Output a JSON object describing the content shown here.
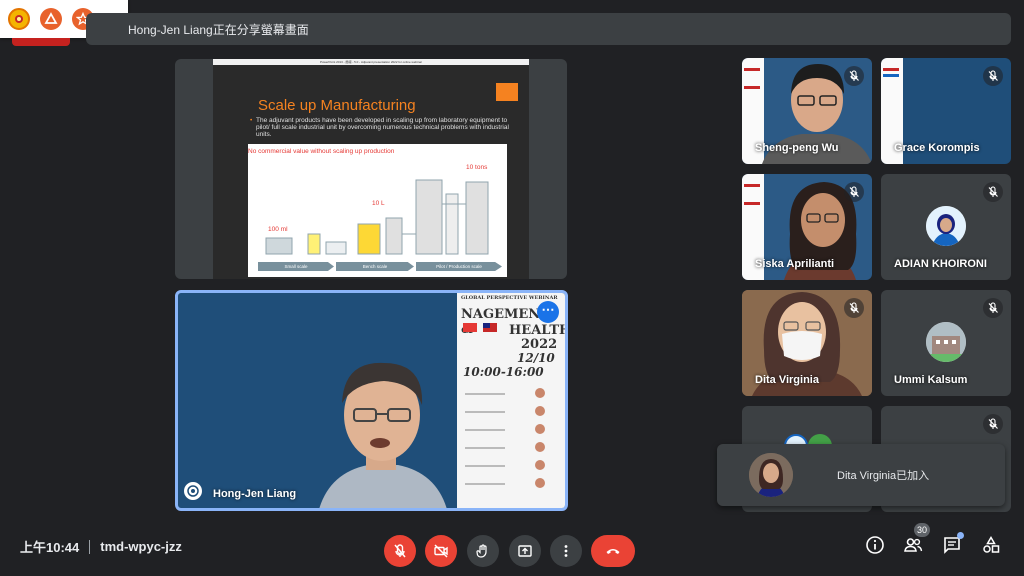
{
  "banner": {
    "text": "Hong-Jen Liang正在分享螢幕畫面"
  },
  "slide": {
    "header": "PowerPoint 2013 - 簡報 - 5.0 - Adjuvant presentation 2022 for online webinar",
    "title": "Scale up Manufacturing",
    "bullet": "The adjuvant products have been developed in scaling up from laboratory equipment to pilot/ full scale industrial unit by overcoming numerous technical problems with industrial units.",
    "caption": "No commercial value without scaling up production",
    "label_100ml": "100 ml",
    "label_10l": "10 L",
    "label_10tons": "10 tons",
    "stages": [
      "Small scale",
      "Bench scale",
      "Pilot / Production scale"
    ]
  },
  "poster": {
    "line1": "GLOBAL PERSPECTIVE WEBINAR",
    "line2": "NAGEMENT &",
    "line3": "HEALTH",
    "line4": "2022",
    "line5": "12/10",
    "line6": "10:00-16:00"
  },
  "speaker": {
    "name": "Hong-Jen Liang"
  },
  "participants": [
    {
      "name": "Sheng-peng Wu",
      "muted": true
    },
    {
      "name": "Grace Korompis",
      "muted": true
    },
    {
      "name": "Siska Aprilianti",
      "muted": true
    },
    {
      "name": "ADIAN KHOIRONI",
      "muted": true
    },
    {
      "name": "Dita Virginia",
      "muted": true
    },
    {
      "name": "Ummi Kalsum",
      "muted": true
    }
  ],
  "toast": {
    "text": "Dita Virginia已加入"
  },
  "footer": {
    "time": "上午10:44",
    "meeting_code": "tmd-wpyc-jzz",
    "participant_count": "30"
  },
  "colors": {
    "accent_blue": "#8ab4f8",
    "danger_red": "#ea4335",
    "orange": "#f58220"
  }
}
